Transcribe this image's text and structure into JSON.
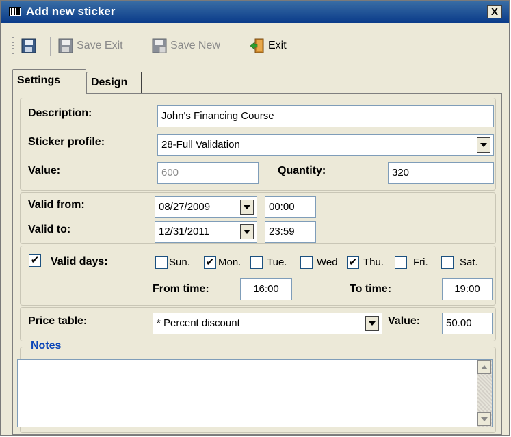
{
  "window": {
    "title": "Add new sticker",
    "close_label": "X"
  },
  "toolbar": {
    "save_exit_label": "Save Exit",
    "save_new_label": "Save New",
    "exit_label": "Exit"
  },
  "tabs": [
    {
      "label": "Settings",
      "active": true
    },
    {
      "label": "Design",
      "active": false
    }
  ],
  "settings": {
    "description_label": "Description:",
    "description_value": "John's Financing Course",
    "profile_label": "Sticker profile:",
    "profile_value": "28-Full Validation",
    "value_label": "Value:",
    "value_value": "600",
    "quantity_label": "Quantity:",
    "quantity_value": "320",
    "valid_from_label": "Valid from:",
    "valid_from_date": "08/27/2009",
    "valid_from_time": "00:00",
    "valid_to_label": "Valid to:",
    "valid_to_date": "12/31/2011",
    "valid_to_time": "23:59",
    "valid_days_label": "Valid days:",
    "valid_days_checked": true,
    "days": [
      {
        "label": "Sun.",
        "checked": false
      },
      {
        "label": "Mon.",
        "checked": true
      },
      {
        "label": "Tue.",
        "checked": false
      },
      {
        "label": "Wed",
        "checked": false
      },
      {
        "label": "Thu.",
        "checked": true
      },
      {
        "label": "Fri.",
        "checked": false
      },
      {
        "label": "Sat.",
        "checked": false
      }
    ],
    "from_time_label": "From time:",
    "from_time_value": "16:00",
    "to_time_label": "To time:",
    "to_time_value": "19:00",
    "price_table_label": "Price table:",
    "price_table_value": "* Percent discount",
    "price_value_label": "Value:",
    "price_value_value": "50.00"
  },
  "notes": {
    "legend": "Notes",
    "value": ""
  },
  "colors": {
    "title_bar": "#0b3c8a",
    "window_bg": "#ece9d8",
    "notes_legend": "#0b46b8"
  }
}
